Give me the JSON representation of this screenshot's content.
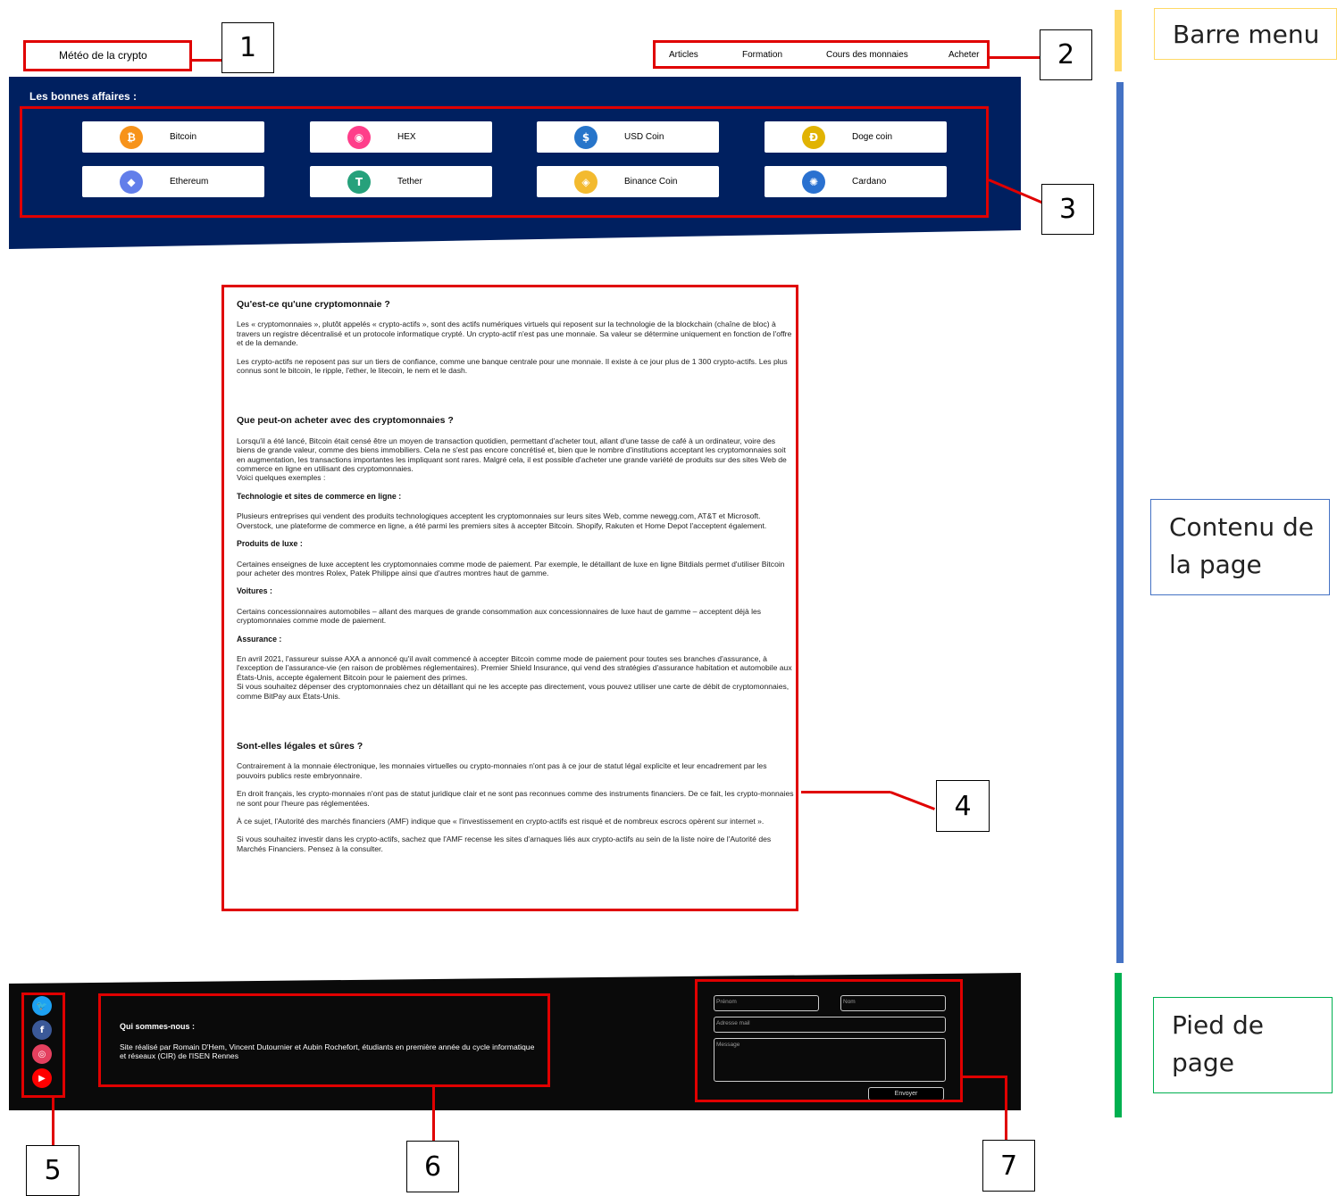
{
  "header": {
    "logo": "Météo de la crypto",
    "nav": [
      "Articles",
      "Formation",
      "Cours des monnaies",
      "Acheter"
    ]
  },
  "hero": {
    "title": "Les bonnes affaires :",
    "coins": [
      {
        "label": "Bitcoin",
        "icon": "bitcoin-icon",
        "glyph": "₿",
        "color": "#f7931a"
      },
      {
        "label": "HEX",
        "icon": "hex-icon",
        "glyph": "◉",
        "color": "#ff3e8a"
      },
      {
        "label": "USD Coin",
        "icon": "usd-coin-icon",
        "glyph": "$",
        "color": "#2775ca"
      },
      {
        "label": "Doge coin",
        "icon": "dogecoin-icon",
        "glyph": "Ð",
        "color": "#e1b303"
      },
      {
        "label": "Ethereum",
        "icon": "ethereum-icon",
        "glyph": "◆",
        "color": "#627eea"
      },
      {
        "label": "Tether",
        "icon": "tether-icon",
        "glyph": "T",
        "color": "#26a17b"
      },
      {
        "label": "Binance Coin",
        "icon": "binance-icon",
        "glyph": "◈",
        "color": "#f3ba2f"
      },
      {
        "label": "Cardano",
        "icon": "cardano-icon",
        "glyph": "✺",
        "color": "#2a71d0"
      }
    ]
  },
  "article": {
    "h1": "Qu'est-ce qu'une cryptomonnaie ?",
    "p1": "Les « cryptomonnaies », plutôt appelés « crypto-actifs », sont des actifs numériques virtuels qui reposent sur la technologie de la blockchain (chaîne de bloc) à travers un registre décentralisé et un protocole informatique crypté. Un crypto-actif n'est pas une monnaie. Sa valeur se détermine uniquement en fonction de l'offre et de la demande.",
    "p2": "Les crypto-actifs ne reposent pas sur un tiers de confiance, comme une banque centrale pour une monnaie. Il existe à ce jour plus de 1 300 crypto-actifs. Les plus connus sont le bitcoin, le ripple, l'ether, le litecoin, le nem et le dash.",
    "h2": "Que peut-on acheter avec des cryptomonnaies ?",
    "p3": "Lorsqu'il a été lancé, Bitcoin était censé être un moyen de transaction quotidien, permettant d'acheter tout, allant d'une tasse de café à un ordinateur, voire des biens de grande valeur, comme des biens immobiliers. Cela ne s'est pas encore concrétisé et, bien que le nombre d'institutions acceptant les cryptomonnaies soit en augmentation, les transactions importantes les impliquant sont rares. Malgré cela, il est possible d'acheter une grande variété de produits sur des sites Web de commerce en ligne en utilisant des cryptomonnaies.\nVoici quelques exemples :",
    "h3a": "Technologie et sites de commerce en ligne :",
    "p4": "Plusieurs entreprises qui vendent des produits technologiques acceptent les cryptomonnaies sur leurs sites Web, comme newegg.com, AT&T et Microsoft. Overstock, une plateforme de commerce en ligne, a été parmi les premiers sites à accepter Bitcoin. Shopify, Rakuten et Home Depot l'acceptent également.",
    "h3b": "Produits de luxe :",
    "p5": "Certaines enseignes de luxe acceptent les cryptomonnaies comme mode de paiement. Par exemple, le détaillant de luxe en ligne Bitdials permet d'utiliser Bitcoin pour acheter des montres Rolex, Patek Philippe ainsi que d'autres montres haut de gamme.",
    "h3c": "Voitures :",
    "p6": "Certains concessionnaires automobiles – allant des marques de grande consommation aux concessionnaires de luxe haut de gamme – acceptent déjà les cryptomonnaies comme mode de paiement.",
    "h3d": "Assurance :",
    "p7": "En avril 2021, l'assureur suisse AXA a annoncé qu'il avait commencé à accepter Bitcoin comme mode de paiement pour toutes ses branches d'assurance, à l'exception de l'assurance-vie (en raison de problèmes réglementaires). Premier Shield Insurance, qui vend des stratégies d'assurance habitation et automobile aux États-Unis, accepte également Bitcoin pour le paiement des primes.\nSi vous souhaitez dépenser des cryptomonnaies chez un détaillant qui ne les accepte pas directement, vous pouvez utiliser une carte de débit de cryptomonnaies, comme BitPay aux États-Unis.",
    "h4": "Sont-elles légales et sûres ?",
    "p8": "Contrairement à la monnaie électronique, les monnaies virtuelles ou crypto-monnaies n'ont pas à ce jour de statut légal explicite et leur encadrement par les pouvoirs publics reste embryonnaire.",
    "p9": "En droit français, les crypto-monnaies n'ont pas de statut juridique clair et ne sont pas reconnues comme des instruments financiers. De ce fait, les crypto-monnaies ne sont pour l'heure pas réglementées.",
    "p10": "À ce sujet, l'Autorité des marchés financiers (AMF) indique que « l'investissement en crypto-actifs est risqué et de nombreux escrocs opèrent sur internet ».",
    "p11": "Si vous souhaitez investir dans les crypto-actifs, sachez que l'AMF recense les sites d'arnaques liés aux crypto-actifs au sein de la liste noire de l'Autorité des Marchés Financiers. Pensez à la consulter."
  },
  "footer": {
    "about_title": "Qui sommes-nous :",
    "about_text": "Site réalisé par Romain D'Hem, Vincent Dutournier et Aubin Rochefort, étudiants en première année du cycle informatique et réseaux (CIR) de l'ISEN Rennes",
    "social": [
      {
        "icon": "twitter-icon",
        "glyph": "🐦",
        "color": "#1da1f2"
      },
      {
        "icon": "facebook-icon",
        "glyph": "f",
        "color": "#3b5998"
      },
      {
        "icon": "instagram-icon",
        "glyph": "◎",
        "color": "#e4405f"
      },
      {
        "icon": "youtube-icon",
        "glyph": "▶",
        "color": "#ff0000"
      }
    ],
    "form": {
      "firstname_placeholder": "Prénom",
      "lastname_placeholder": "Nom",
      "email_placeholder": "Adresse mail",
      "message_placeholder": "Message",
      "send_label": "Envoyer"
    }
  },
  "callouts": [
    "1",
    "2",
    "3",
    "4",
    "5",
    "6",
    "7"
  ],
  "legend": {
    "menu": "Barre menu",
    "content": "Contenu de la page",
    "footer": "Pied de page"
  },
  "colors": {
    "hero_blue": "#002060",
    "footer_black": "#0a0a0a",
    "annotation_red": "#e00000",
    "legend_yellow": "#ffd966",
    "legend_blue": "#4472c4",
    "legend_green": "#00b050"
  }
}
